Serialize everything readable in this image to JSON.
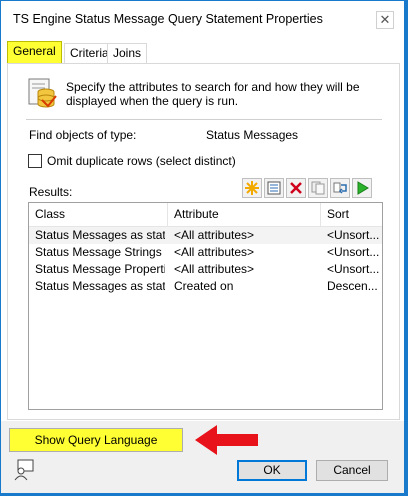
{
  "window": {
    "title": "TS Engine Status Message Query Statement Properties",
    "close_glyph": "✕"
  },
  "tabs": [
    {
      "label": "General"
    },
    {
      "label": "Criteria"
    },
    {
      "label": "Joins"
    }
  ],
  "general": {
    "description": "Specify the attributes to search for and how they will be displayed when the query is run.",
    "find_label": "Find objects of type:",
    "find_value": "Status Messages",
    "omit_duplicates_label": "Omit duplicate rows (select distinct)",
    "results_label": "Results:"
  },
  "results": {
    "columns": [
      "Class",
      "Attribute",
      "Sort"
    ],
    "rows": [
      {
        "class": "Status Messages as stat",
        "attribute": "<All attributes>",
        "sort": "<Unsort..."
      },
      {
        "class": "Status Message Strings a...",
        "attribute": "<All attributes>",
        "sort": "<Unsort..."
      },
      {
        "class": "Status Message Properti...",
        "attribute": "<All attributes>",
        "sort": "<Unsort..."
      },
      {
        "class": "Status Messages as stat",
        "attribute": "Created on",
        "sort": "Descen..."
      }
    ]
  },
  "toolbar_icons": [
    "new-icon",
    "properties-icon",
    "delete-icon",
    "copy-icon",
    "swap-icon",
    "run-icon"
  ],
  "buttons": {
    "show_query_language": "Show Query Language",
    "ok": "OK",
    "cancel": "Cancel"
  },
  "colors": {
    "highlight": "#ffff33",
    "arrow": "#e8131a",
    "accent": "#0078d7"
  }
}
